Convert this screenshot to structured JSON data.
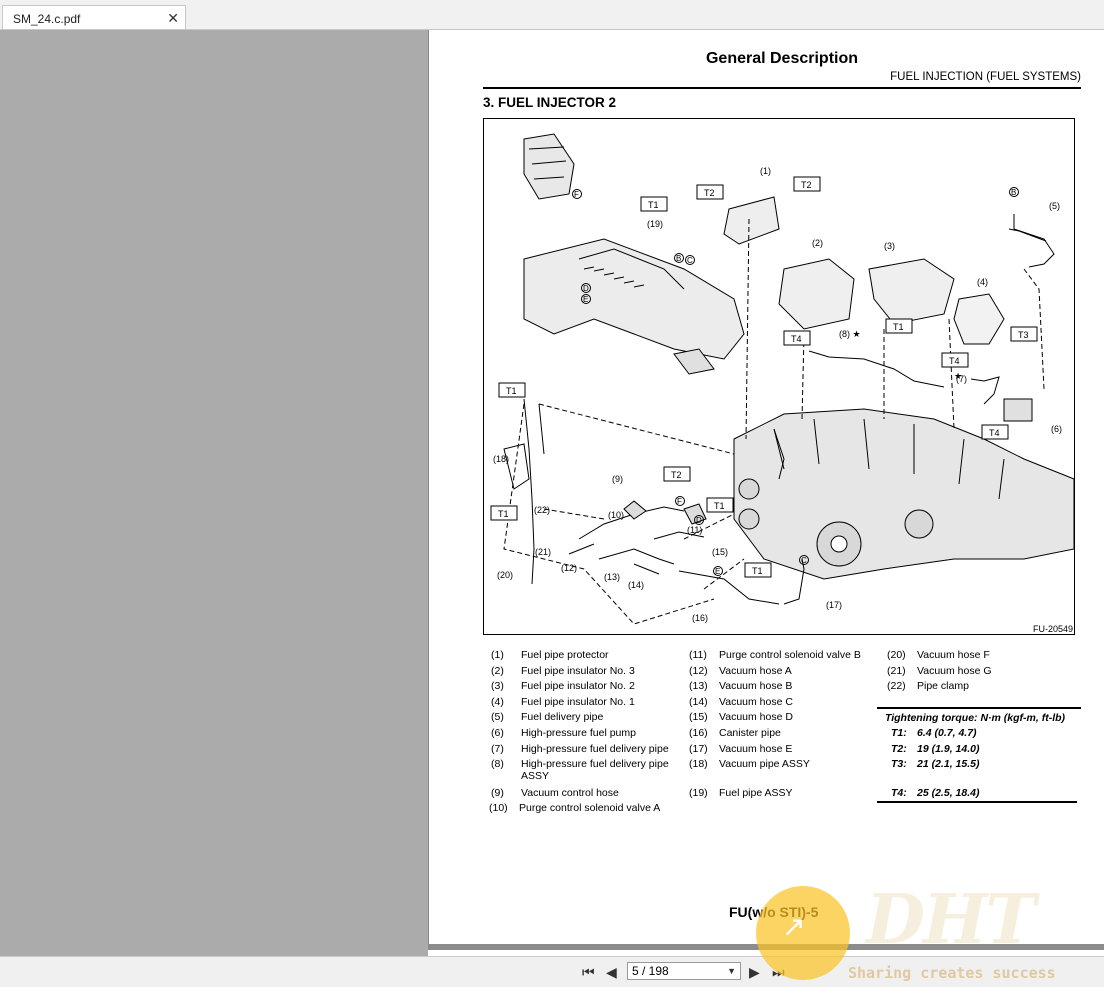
{
  "tab": {
    "title": "SM_24.c.pdf",
    "close": "✕"
  },
  "page": {
    "title": "General Description",
    "subtitle": "FUEL INJECTION (FUEL SYSTEMS)",
    "section": "3.  FUEL INJECTOR 2",
    "figure_code": "FU-20549",
    "footer": "FU(w/o STI)-5"
  },
  "figure_labels": [
    "(1)",
    "(2)",
    "(3)",
    "(4)",
    "(5)",
    "(6)",
    "(7)",
    "(8)",
    "(9)",
    "(10)",
    "(11)",
    "(12)",
    "(13)",
    "(14)",
    "(15)",
    "(16)",
    "(17)",
    "(18)",
    "(19)",
    "(20)",
    "(21)",
    "(22)",
    "T1",
    "T2",
    "T3",
    "T4",
    "B",
    "C",
    "D",
    "E",
    "F",
    "★"
  ],
  "legend": [
    {
      "num": "(1)",
      "text": "Fuel pipe protector"
    },
    {
      "num": "(2)",
      "text": "Fuel pipe insulator No. 3"
    },
    {
      "num": "(3)",
      "text": "Fuel pipe insulator No. 2"
    },
    {
      "num": "(4)",
      "text": "Fuel pipe insulator No. 1"
    },
    {
      "num": "(5)",
      "text": "Fuel delivery pipe"
    },
    {
      "num": "(6)",
      "text": "High-pressure fuel pump"
    },
    {
      "num": "(7)",
      "text": "High-pressure fuel delivery pipe"
    },
    {
      "num": "(8)",
      "text": "High-pressure fuel delivery pipe"
    },
    {
      "num": "",
      "text": "ASSY"
    },
    {
      "num": "(9)",
      "text": "Vacuum control hose"
    },
    {
      "num": "(10)",
      "text": "Purge control solenoid valve A"
    },
    {
      "num": "(11)",
      "text": "Purge control solenoid valve B"
    },
    {
      "num": "(12)",
      "text": "Vacuum hose A"
    },
    {
      "num": "(13)",
      "text": "Vacuum hose B"
    },
    {
      "num": "(14)",
      "text": "Vacuum hose C"
    },
    {
      "num": "(15)",
      "text": "Vacuum hose D"
    },
    {
      "num": "(16)",
      "text": "Canister pipe"
    },
    {
      "num": "(17)",
      "text": "Vacuum hose E"
    },
    {
      "num": "(18)",
      "text": "Vacuum pipe ASSY"
    },
    {
      "num": "(19)",
      "text": "Fuel pipe ASSY"
    },
    {
      "num": "(20)",
      "text": "Vacuum hose F"
    },
    {
      "num": "(21)",
      "text": "Vacuum hose G"
    },
    {
      "num": "(22)",
      "text": "Pipe clamp"
    }
  ],
  "torque": {
    "title": "Tightening torque: N·m (kgf-m, ft-lb)",
    "rows": [
      {
        "key": "T1:",
        "value": "6.4 (0.7, 4.7)"
      },
      {
        "key": "T2:",
        "value": "19 (1.9, 14.0)"
      },
      {
        "key": "T3:",
        "value": "21 (2.1, 15.5)"
      },
      {
        "key": "T4:",
        "value": "25 (2.5, 18.4)"
      }
    ]
  },
  "watermark": {
    "logo_text": "DHT",
    "tagline": "Sharing creates success"
  },
  "toolbar": {
    "page_indicator": "5 / 198",
    "first": "⏮",
    "prev": "◀",
    "next": "▶",
    "last": "⏭",
    "select_arrow": "▼"
  }
}
